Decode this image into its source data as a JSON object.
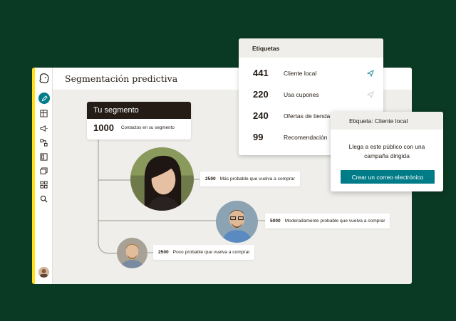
{
  "app": {
    "page_title": "Segmentación predictiva"
  },
  "segment": {
    "title": "Tu segmento",
    "count": "1000",
    "caption": "Contactos en su segmento"
  },
  "tags": [
    {
      "count": "2500",
      "text": "Más probable que vuelva a comprar"
    },
    {
      "count": "5000",
      "text": "Moderadamente probable que vuelva a comprar"
    },
    {
      "count": "2500",
      "text": "Poco probable que vuelva a comprar"
    }
  ],
  "labels_panel": {
    "title": "Etiquetas",
    "rows": [
      {
        "count": "441",
        "name": "Cliente local",
        "icon": "send-icon"
      },
      {
        "count": "220",
        "name": "Usa cupones",
        "icon": "send-icon"
      },
      {
        "count": "240",
        "name": "Ofertas de tienda",
        "icon": ""
      },
      {
        "count": "99",
        "name": "Recomendación",
        "icon": ""
      }
    ]
  },
  "popover": {
    "title": "Etiqueta: Cliente local",
    "text": "Llega a este público con una campaña dirigida",
    "button_label": "Crear un correo electrónico"
  },
  "colors": {
    "background": "#0b3a24",
    "accent": "#ffe01b",
    "primary": "#007c89",
    "dark": "#241c15"
  }
}
